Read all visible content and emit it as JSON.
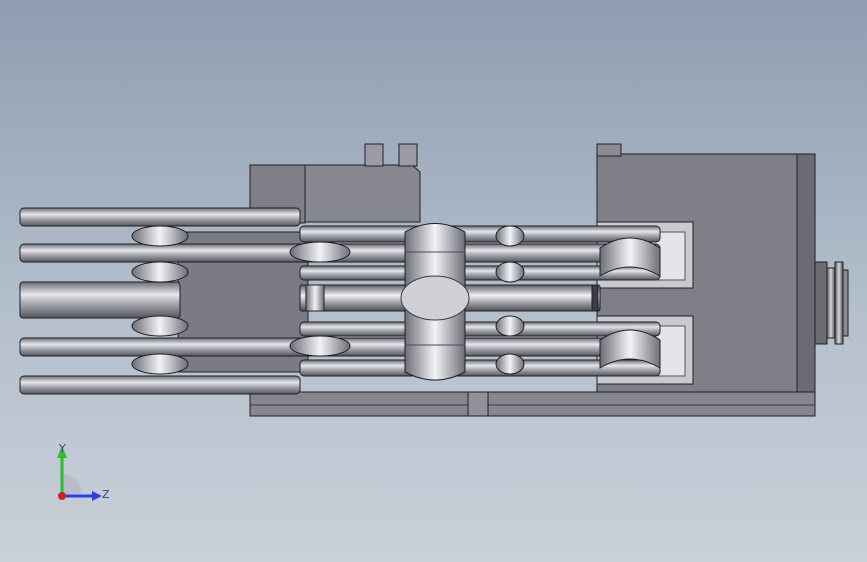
{
  "viewport": {
    "background_top": "#8f9db1",
    "background_bottom": "#c9d0d9"
  },
  "model": {
    "body_color": "#7d7e86",
    "body_dark": "#5a5b62",
    "edge_color": "#1f2024",
    "chrome_light": "#e8e9ee"
  },
  "triad": {
    "y_label": "Y",
    "z_label": "Z",
    "y_color": "#2bbf2b",
    "z_color": "#2f3fe0",
    "x_color": "#d02020"
  }
}
